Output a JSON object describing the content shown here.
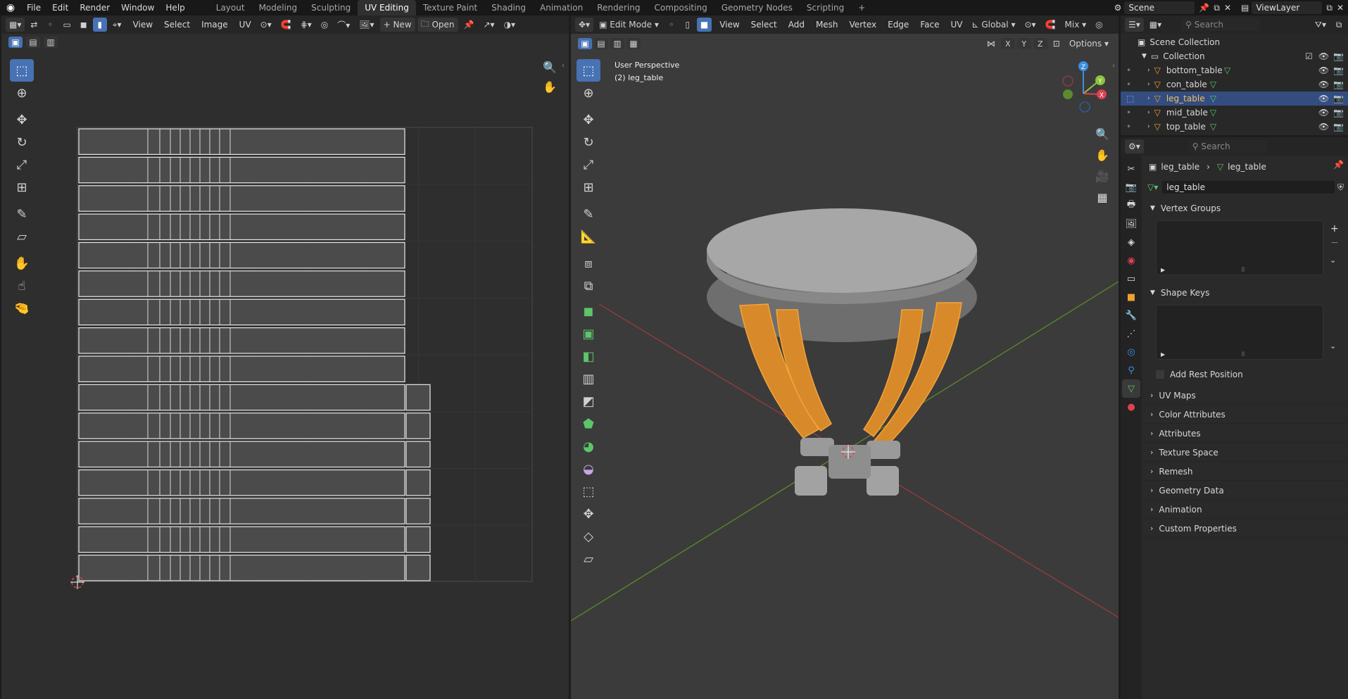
{
  "menu": {
    "file": "File",
    "edit": "Edit",
    "render": "Render",
    "window": "Window",
    "help": "Help"
  },
  "workspaces": [
    "Layout",
    "Modeling",
    "Sculpting",
    "UV Editing",
    "Texture Paint",
    "Shading",
    "Animation",
    "Rendering",
    "Compositing",
    "Geometry Nodes",
    "Scripting"
  ],
  "scene": {
    "scene_name": "Scene",
    "view_layer": "ViewLayer"
  },
  "uv_editor": {
    "header": {
      "view": "View",
      "select": "Select",
      "image": "Image",
      "uv": "UV",
      "new": "New",
      "open": "Open"
    },
    "tools": [
      "select-box-icon",
      "cursor-icon",
      "move-icon",
      "rotate-icon",
      "scale-icon",
      "transform-icon",
      "annotate-icon",
      "rip-icon",
      "grab-icon",
      "relax-icon",
      "pinch-icon"
    ]
  },
  "viewport": {
    "header": {
      "mode": "Edit Mode",
      "view": "View",
      "select": "Select",
      "add": "Add",
      "mesh": "Mesh",
      "vertex": "Vertex",
      "edge": "Edge",
      "face": "Face",
      "uv": "UV",
      "orientation": "Global",
      "proportional": "Mix",
      "options": "Options",
      "axes": [
        "X",
        "Y",
        "Z"
      ]
    },
    "overlay_title": "User Perspective",
    "overlay_object": "(2) leg_table",
    "gizmo": {
      "z": "Z",
      "y": "Y",
      "x": "X"
    },
    "tools": [
      "select-box-icon",
      "cursor-icon",
      "move-icon",
      "rotate-icon",
      "scale-icon",
      "transform-icon",
      "annotate-icon",
      "measure-icon",
      "add-cube-icon",
      "extrude-icon",
      "inset-icon",
      "bevel-icon",
      "loop-cut-icon",
      "knife-icon",
      "poly-build-icon",
      "spin-icon",
      "smooth-icon",
      "shrink-icon",
      "push-pull-icon",
      "shear-icon",
      "rip-region-icon"
    ]
  },
  "outliner": {
    "search_placeholder": "Search",
    "scene_collection": "Scene Collection",
    "collection": "Collection",
    "objects": [
      {
        "name": "bottom_table",
        "selected": false
      },
      {
        "name": "con_table",
        "selected": false
      },
      {
        "name": "leg_table",
        "selected": true
      },
      {
        "name": "mid_table",
        "selected": false
      },
      {
        "name": "top_table",
        "selected": false
      }
    ]
  },
  "properties": {
    "search_placeholder": "Search",
    "breadcrumb_object": "leg_table",
    "breadcrumb_mesh": "leg_table",
    "mesh_name": "leg_table",
    "vertex_groups": "Vertex Groups",
    "shape_keys": "Shape Keys",
    "add_rest_position": "Add Rest Position",
    "sections": [
      "UV Maps",
      "Color Attributes",
      "Attributes",
      "Texture Space",
      "Remesh",
      "Geometry Data",
      "Animation",
      "Custom Properties"
    ]
  },
  "colors": {
    "accent": "#4772b3",
    "selection_orange": "#f0a030",
    "outliner_select": "#334d80",
    "axis_x": "#e04050",
    "axis_y": "#8cc43c",
    "axis_z": "#3b8ee0"
  }
}
